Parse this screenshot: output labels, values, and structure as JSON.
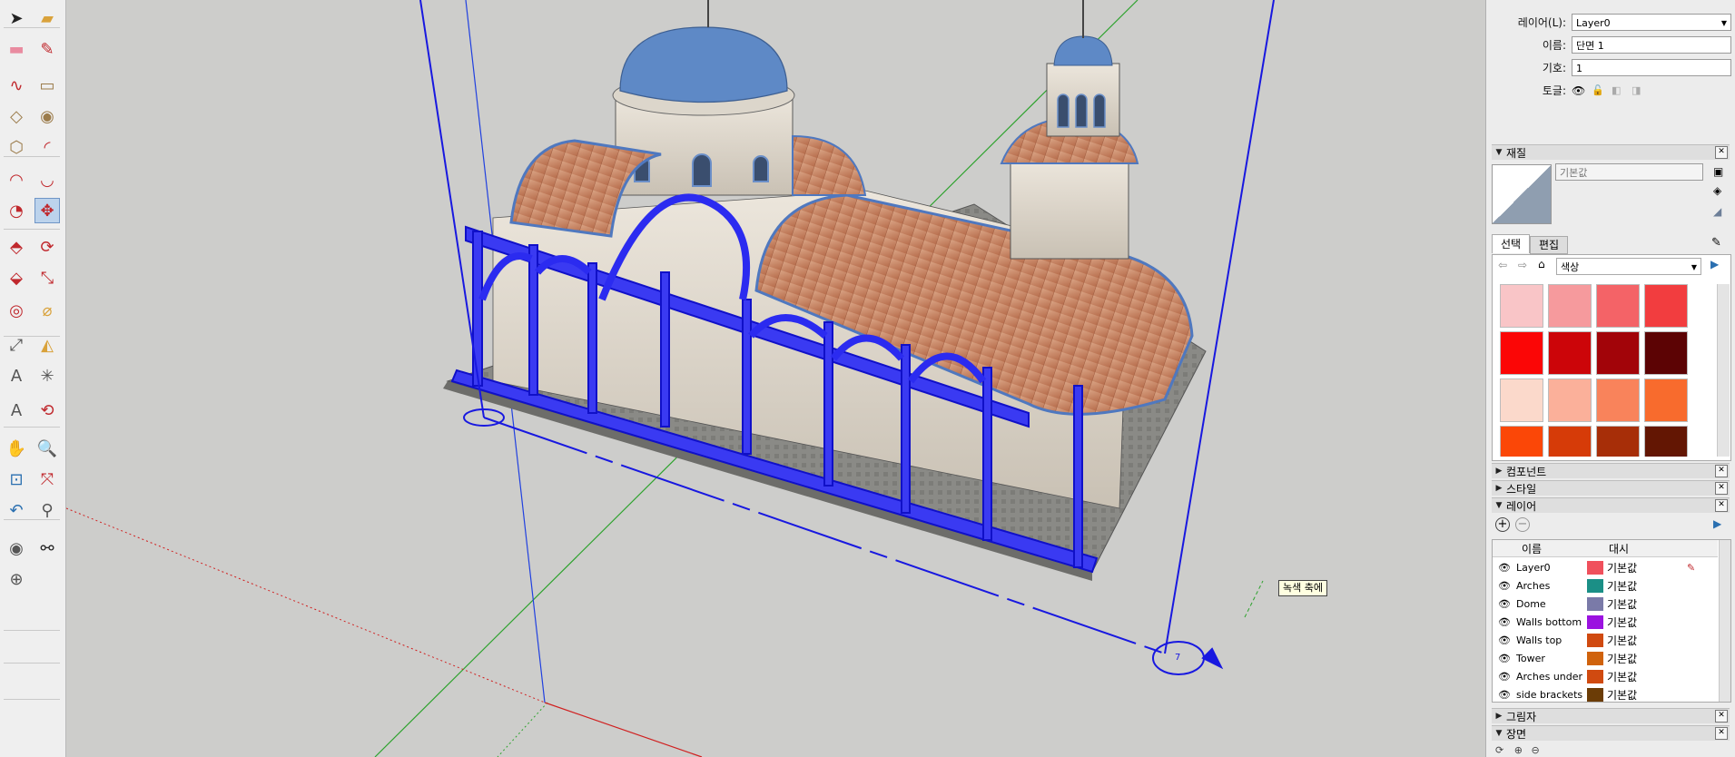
{
  "toolbar": {
    "tools": [
      {
        "name": "select-tool-icon",
        "color": "#222"
      },
      {
        "name": "paint-bucket-icon",
        "color": "#d9a23b"
      },
      {
        "name": "eraser-icon",
        "color": "#e98ba0"
      },
      {
        "name": "pencil-line-icon",
        "color": "#c0282d"
      },
      {
        "name": "freehand-icon",
        "color": "#c0282d"
      },
      {
        "name": "rectangle-icon",
        "color": "#9b7b4a"
      },
      {
        "name": "rotated-rectangle-icon",
        "color": "#9b7b4a"
      },
      {
        "name": "circle-icon",
        "color": "#9b7b4a"
      },
      {
        "name": "polygon-icon",
        "color": "#9b7b4a"
      },
      {
        "name": "arc-icon",
        "color": "#c0282d"
      },
      {
        "name": "two-point-arc-icon",
        "color": "#c0282d"
      },
      {
        "name": "three-point-arc-icon",
        "color": "#c0282d"
      },
      {
        "name": "pie-icon",
        "color": "#c0282d"
      },
      {
        "name": "move-icon",
        "color": "#c0282d"
      },
      {
        "name": "push-pull-icon",
        "color": "#c0282d"
      },
      {
        "name": "rotate-icon",
        "color": "#c0282d"
      },
      {
        "name": "follow-me-icon",
        "color": "#c0282d"
      },
      {
        "name": "scale-icon",
        "color": "#c0282d"
      },
      {
        "name": "offset-icon",
        "color": "#c0282d"
      },
      {
        "name": "tape-measure-icon",
        "color": "#d9a23b"
      },
      {
        "name": "dimension-icon",
        "color": "#555"
      },
      {
        "name": "protractor-icon",
        "color": "#d9a23b"
      },
      {
        "name": "text-icon",
        "color": "#555"
      },
      {
        "name": "axes-icon",
        "color": "#555"
      },
      {
        "name": "3d-text-icon",
        "color": "#555"
      },
      {
        "name": "orbit-icon",
        "color": "#c0282d"
      },
      {
        "name": "pan-icon",
        "color": "#d9a23b"
      },
      {
        "name": "zoom-icon",
        "color": "#2a6fb0"
      },
      {
        "name": "zoom-window-icon",
        "color": "#2a6fb0"
      },
      {
        "name": "zoom-extents-icon",
        "color": "#c0282d"
      },
      {
        "name": "previous-view-icon",
        "color": "#2a6fb0"
      },
      {
        "name": "position-camera-icon",
        "color": "#555"
      },
      {
        "name": "look-around-icon",
        "color": "#555"
      },
      {
        "name": "walk-icon",
        "color": "#222"
      },
      {
        "name": "section-plane-icon",
        "color": "#555"
      }
    ]
  },
  "viewport": {
    "tooltip": "녹색 축에",
    "section_marker_label": "7"
  },
  "entity_info": {
    "layer_label": "레이어(L):",
    "layer_value": "Layer0",
    "name_label": "이름:",
    "name_value": "단면 1",
    "symbol_label": "기호:",
    "symbol_value": "1",
    "toggle_label": "토글:"
  },
  "materials": {
    "title": "재질",
    "material_name": "기본값",
    "tab_select": "선택",
    "tab_edit": "편집",
    "collection": "색상",
    "swatches": [
      "#f9c5c7",
      "#f69a9d",
      "#f46367",
      "#f23d3f",
      "#fb0606",
      "#cc0509",
      "#a20409",
      "#5c0304",
      "#fbd9cb",
      "#fbb09a",
      "#f9835b",
      "#f86b2d",
      "#fb4707",
      "#d63b08",
      "#a72e08",
      "#631603"
    ]
  },
  "panels": {
    "components": "컴포넌트",
    "styles": "스타일",
    "layers": "레이어",
    "shadows": "그림자",
    "scenes": "장면"
  },
  "layers": {
    "col_name": "이름",
    "col_dash": "대시",
    "rows": [
      {
        "name": "Layer0",
        "color": "#f0505c",
        "dash": "기본값"
      },
      {
        "name": "Arches",
        "color": "#1b8f86",
        "dash": "기본값"
      },
      {
        "name": "Dome",
        "color": "#7a7aa8",
        "dash": "기본값"
      },
      {
        "name": "Walls bottom",
        "color": "#9b12e0",
        "dash": "기본값"
      },
      {
        "name": "Walls top",
        "color": "#d04a10",
        "dash": "기본값"
      },
      {
        "name": "Tower",
        "color": "#d0620c",
        "dash": "기본값"
      },
      {
        "name": "Arches under",
        "color": "#d04a10",
        "dash": "기본값"
      },
      {
        "name": "side brackets",
        "color": "#6b3c06",
        "dash": "기본값"
      }
    ]
  }
}
